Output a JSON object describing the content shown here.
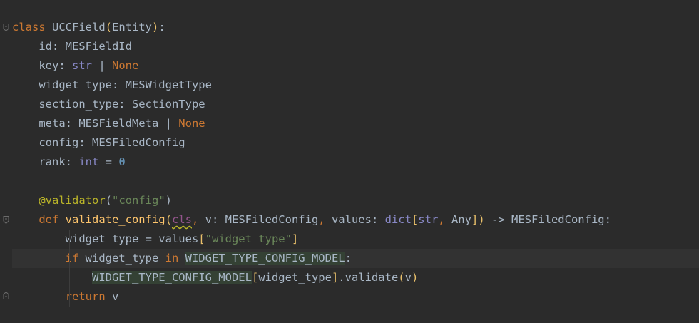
{
  "editor": {
    "lines": [
      [
        {
          "t": "class ",
          "c": "kw"
        },
        {
          "t": "UCCField"
        },
        {
          "t": "(",
          "c": "br"
        },
        {
          "t": "Entity"
        },
        {
          "t": ")",
          "c": "br"
        },
        {
          "t": ":"
        }
      ],
      [
        {
          "t": "    id: MESFieldId"
        }
      ],
      [
        {
          "t": "    key: "
        },
        {
          "t": "str",
          "c": "bi"
        },
        {
          "t": " | "
        },
        {
          "t": "None",
          "c": "kw"
        }
      ],
      [
        {
          "t": "    widget_type: MESWidgetType"
        }
      ],
      [
        {
          "t": "    section_type: SectionType"
        }
      ],
      [
        {
          "t": "    meta: MESFieldMeta | "
        },
        {
          "t": "None",
          "c": "kw"
        }
      ],
      [
        {
          "t": "    config: MESFiledConfig"
        }
      ],
      [
        {
          "t": "    rank: "
        },
        {
          "t": "int",
          "c": "bi"
        },
        {
          "t": " = "
        },
        {
          "t": "0",
          "c": "num"
        }
      ],
      [
        {
          "t": ""
        }
      ],
      [
        {
          "t": "    "
        },
        {
          "t": "@validator",
          "c": "dec"
        },
        {
          "t": "("
        },
        {
          "t": "\"config\"",
          "c": "str"
        },
        {
          "t": ")"
        }
      ],
      [
        {
          "t": "    "
        },
        {
          "t": "def ",
          "c": "kw"
        },
        {
          "t": "validate_config",
          "c": "fn"
        },
        {
          "t": "(",
          "c": "br"
        },
        {
          "t": "cls",
          "c": "self warn"
        },
        {
          "t": ", ",
          "c": "kw"
        },
        {
          "t": "v: MESFiledConfig"
        },
        {
          "t": ", ",
          "c": "kw"
        },
        {
          "t": "values: "
        },
        {
          "t": "dict",
          "c": "bi"
        },
        {
          "t": "[",
          "c": "br"
        },
        {
          "t": "str",
          "c": "bi"
        },
        {
          "t": ", ",
          "c": "kw"
        },
        {
          "t": "Any"
        },
        {
          "t": "]",
          "c": "br"
        },
        {
          "t": ")",
          "c": "br"
        },
        {
          "t": " -> MESFiledConfig:"
        }
      ],
      [
        {
          "t": "        widget_type = values"
        },
        {
          "t": "[",
          "c": "br"
        },
        {
          "t": "\"widget_type\"",
          "c": "str"
        },
        {
          "t": "]",
          "c": "br"
        }
      ],
      [
        {
          "t": "        "
        },
        {
          "t": "if ",
          "c": "kw"
        },
        {
          "t": "widget_type "
        },
        {
          "t": "in ",
          "c": "kw"
        },
        {
          "t": "WIDGET_TYPE_CONFIG_MODEL",
          "c": "hl"
        },
        {
          "t": ":"
        }
      ],
      [
        {
          "t": "            "
        },
        {
          "t": "WIDGET_TYPE_CONFIG_MODEL",
          "c": "hl"
        },
        {
          "t": "[",
          "c": "br"
        },
        {
          "t": "widget_type"
        },
        {
          "t": "]",
          "c": "br"
        },
        {
          "t": ".validate"
        },
        {
          "t": "(",
          "c": "br"
        },
        {
          "t": "v"
        },
        {
          "t": ")",
          "c": "br"
        }
      ],
      [
        {
          "t": "        "
        },
        {
          "t": "return ",
          "c": "kw"
        },
        {
          "t": "v"
        }
      ]
    ]
  }
}
